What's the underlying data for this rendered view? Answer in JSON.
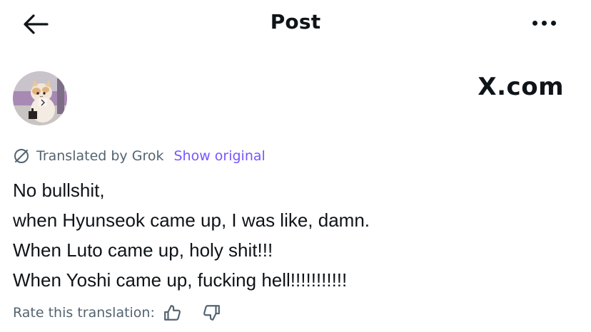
{
  "header": {
    "title": "Post",
    "back_icon": "arrow-left-icon",
    "more_icon": "more-dots-icon"
  },
  "post": {
    "brand": "X.com",
    "translation": {
      "label": "Translated by Grok",
      "show_original": "Show original"
    },
    "text_lines": [
      "No bullshit,",
      "when Hyunseok came up, I was like, damn.",
      "When Luto came up, holy shit!!!",
      "When Yoshi came up, fucking hell!!!!!!!!!!!"
    ],
    "rate": {
      "label": "Rate this translation:",
      "up_icon": "thumbs-up-icon",
      "down_icon": "thumbs-down-icon"
    }
  },
  "colors": {
    "text": "#0f1419",
    "secondary": "#536471",
    "accent": "#7856ff"
  }
}
